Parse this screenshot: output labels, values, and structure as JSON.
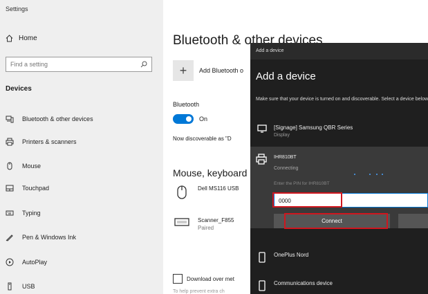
{
  "app": {
    "title": "Settings"
  },
  "sidebar": {
    "home_label": "Home",
    "search_placeholder": "Find a setting",
    "section_heading": "Devices",
    "items": [
      {
        "label": "Bluetooth & other devices",
        "icon": "bluetooth-devices-icon"
      },
      {
        "label": "Printers & scanners",
        "icon": "printer-icon"
      },
      {
        "label": "Mouse",
        "icon": "mouse-icon"
      },
      {
        "label": "Touchpad",
        "icon": "touchpad-icon"
      },
      {
        "label": "Typing",
        "icon": "keyboard-icon"
      },
      {
        "label": "Pen & Windows Ink",
        "icon": "pen-icon"
      },
      {
        "label": "AutoPlay",
        "icon": "autoplay-icon"
      },
      {
        "label": "USB",
        "icon": "usb-icon"
      }
    ]
  },
  "main": {
    "title": "Bluetooth & other devices",
    "add_device_label": "Add Bluetooth o",
    "bluetooth_label": "Bluetooth",
    "bluetooth_state": "On",
    "discoverable_text": "Now discoverable as \"D",
    "section_mouse": "Mouse, keyboard",
    "devices": [
      {
        "name": "Dell MS116 USB",
        "status": ""
      },
      {
        "name": "Scanner_F855",
        "status": "Paired"
      }
    ],
    "download_label": "Download over met",
    "faded_text": "To help prevent extra ch"
  },
  "dialog": {
    "titlebar": "Add a device",
    "heading": "Add a device",
    "instructions": "Make sure that your device is turned on and discoverable. Select a device below to connect.",
    "devices": [
      {
        "name": "[Signage] Samsung QBR Series",
        "type": "Display",
        "icon": "monitor-icon"
      },
      {
        "name": "OnePlus Nord",
        "type": "",
        "icon": "phone-icon"
      },
      {
        "name": "Communications device",
        "type": "",
        "icon": "phone-icon"
      }
    ],
    "selected": {
      "name": "IHR810BT",
      "status": "Connecting",
      "pin_prompt": "Enter the PIN for IHR810BT",
      "pin_value": "0000",
      "connect_label": "Connect"
    }
  },
  "colors": {
    "accent": "#0078d7",
    "highlight": "#d0161e",
    "dialog_bg": "#1f1f1f"
  }
}
